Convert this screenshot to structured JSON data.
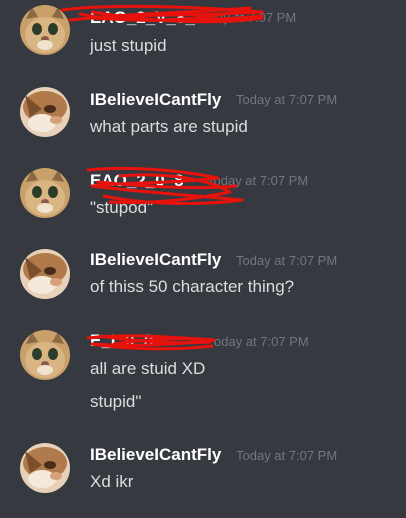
{
  "messages": [
    {
      "id": "m1",
      "author": "[redacted]",
      "author_redacted": true,
      "author_visible_fragment": "EAO_2_V_8_",
      "timestamp": "7:07 PM",
      "timestamp_partial": "Today at 7:07 PM",
      "avatar": "cat-avatar-a",
      "lines": [
        "just stupid"
      ]
    },
    {
      "id": "m2",
      "author": "IBelieveICantFly",
      "author_redacted": false,
      "timestamp": "Today at 7:07 PM",
      "avatar": "cat-avatar-b",
      "lines": [
        "what parts are stupid"
      ]
    },
    {
      "id": "m3",
      "author": "[redacted]",
      "author_redacted": true,
      "author_visible_fragment": "EAO_2_0_8_",
      "timestamp": "Today at 7:07 PM",
      "avatar": "cat-avatar-a",
      "lines": [
        "\"stupod\""
      ]
    },
    {
      "id": "m4",
      "author": "IBelieveICantFly",
      "author_redacted": false,
      "timestamp": "Today at 7:07 PM",
      "avatar": "cat-avatar-b",
      "lines": [
        "of thiss 50 character thing?"
      ]
    },
    {
      "id": "m5",
      "author": "[redacted]",
      "author_redacted": true,
      "author_visible_fragment": "E_I_0_8",
      "timestamp": "Today at 7:07 PM",
      "timestamp_partial": "oday at 7:07 PM",
      "avatar": "cat-avatar-a",
      "lines": [
        "all are stuid XD",
        "stupid\""
      ]
    },
    {
      "id": "m6",
      "author": "IBelieveICantFly",
      "author_redacted": false,
      "timestamp": "Today at 7:07 PM",
      "avatar": "cat-avatar-b",
      "lines": [
        "Xd ikr"
      ]
    }
  ],
  "colors": {
    "background": "#36393f",
    "username": "#ffffff",
    "message_text": "#dcddde",
    "timestamp": "#72767d",
    "redaction": "#e8120c"
  }
}
